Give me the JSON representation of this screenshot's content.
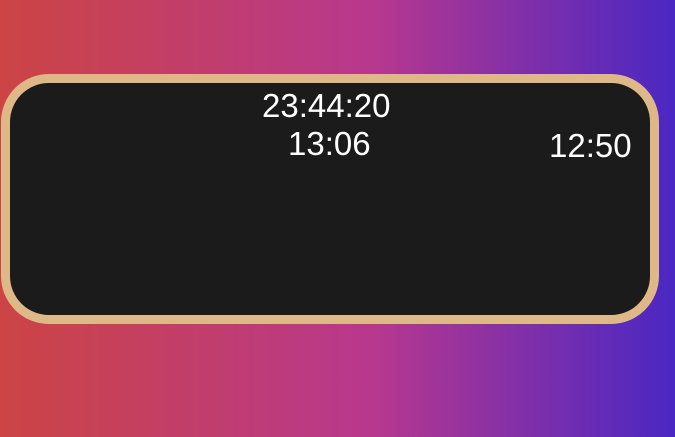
{
  "theme": {
    "gradient_start": "#cc4444",
    "gradient_mid": "#b8388e",
    "gradient_end": "#4a27c3",
    "panel_background": "#1b1b1b",
    "panel_border": "#deb887",
    "text_color": "#ffffff"
  },
  "clock": {
    "main_time": "23:44:20",
    "secondary_time": "13:06",
    "right_time": "12:50"
  }
}
